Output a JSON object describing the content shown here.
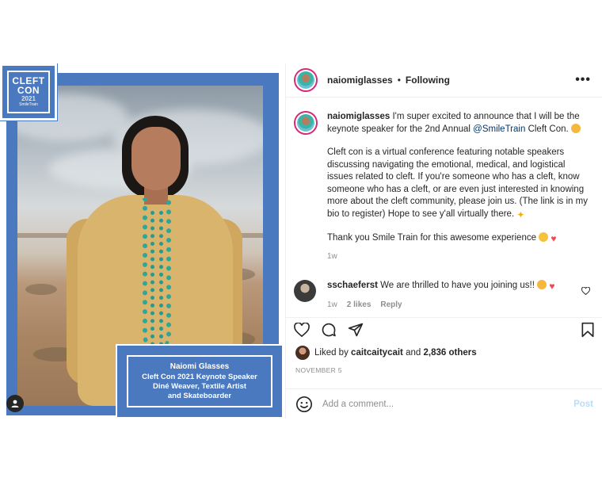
{
  "post": {
    "author": {
      "username": "naiomiglasses",
      "follow_status": "Following",
      "separator": "•"
    },
    "image": {
      "logo": {
        "line1": "CLEFT",
        "line2": "CON",
        "year": "2021",
        "brand": "SmileTrain"
      },
      "card": {
        "name": "Naiomi Glasses",
        "line2": "Cleft Con 2021 Keynote Speaker",
        "line3": "Diné Weaver, Textile Artist",
        "line4": "and Skateboarder"
      }
    },
    "caption": {
      "username": "naiomiglasses",
      "intro_before_mention": "I'm super excited to announce that I will be the keynote speaker for the 2nd Annual",
      "mention": "@SmileTrain",
      "intro_after_mention": "Cleft Con.",
      "para2": "Cleft con is a virtual conference featuring notable speakers discussing navigating the emotional, medical, and logistical issues related to cleft. If you're someone who has a cleft, know someone who has a cleft, or are even just interested in knowing more about the cleft community, please join us. (The link is in my bio to register) Hope to see y'all virtually there.",
      "para3": "Thank you Smile Train for this awesome experience",
      "age": "1w"
    },
    "comments": [
      {
        "username": "sschaeferst",
        "text": "We are thrilled to have you joining us!!",
        "age": "1w",
        "likes": "2 likes",
        "reply_label": "Reply"
      }
    ],
    "likes_line": {
      "prefix": "Liked by",
      "user": "caitcaitycait",
      "joiner": "and",
      "others": "2,836 others"
    },
    "date": "NOVEMBER 5",
    "add_comment": {
      "placeholder": "Add a comment...",
      "post_label": "Post"
    }
  },
  "icons": {
    "more": "more-options-icon",
    "like": "heart-icon",
    "comment": "comment-icon",
    "share": "share-icon",
    "save": "bookmark-icon",
    "emoji": "emoji-icon",
    "tagged": "tagged-user-icon"
  },
  "colors": {
    "frame_blue": "#4a79bf",
    "link": "#00376b",
    "muted": "#8e8e8e",
    "post_button_disabled": "#b2dffc",
    "heart": "#ed4956"
  }
}
